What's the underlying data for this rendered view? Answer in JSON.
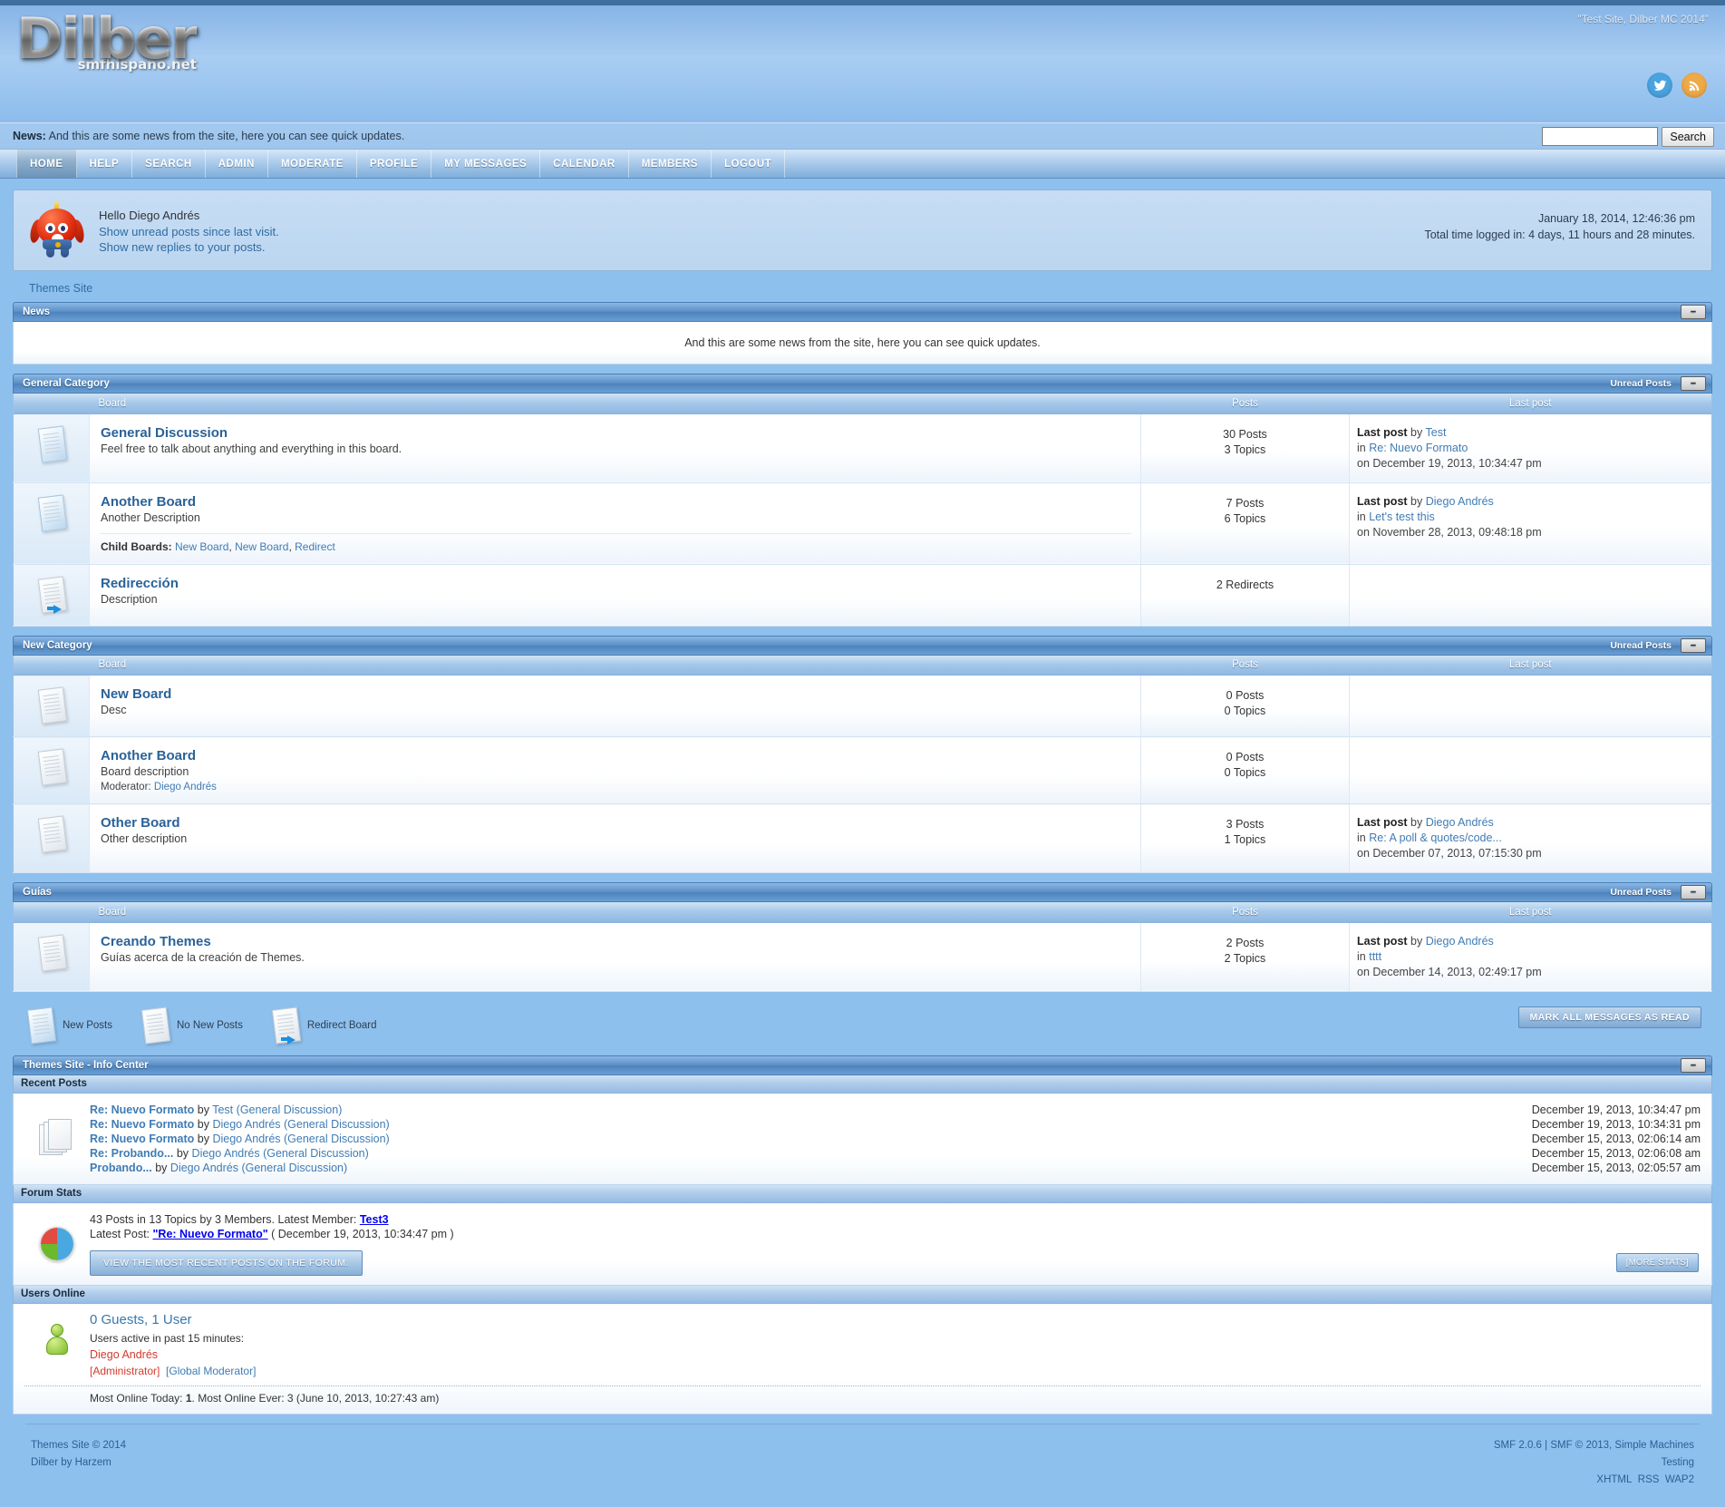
{
  "header": {
    "logo_main": "Dilber",
    "logo_sub": "smfhispano.net",
    "slogan": "\"Test Site, Dilber MC 2014\"",
    "social": [
      {
        "name": "twitter-icon",
        "glyph": "ᵗ"
      },
      {
        "name": "rss-icon",
        "glyph": "●"
      }
    ]
  },
  "news_strip": {
    "label": "News:",
    "text": " And this are some news from the site, here you can see quick updates.",
    "search_placeholder": "",
    "search_value": "",
    "search_button": "Search"
  },
  "menu": [
    {
      "label": "HOME",
      "active": true
    },
    {
      "label": "HELP",
      "active": false
    },
    {
      "label": "SEARCH",
      "active": false
    },
    {
      "label": "ADMIN",
      "active": false
    },
    {
      "label": "MODERATE",
      "active": false
    },
    {
      "label": "PROFILE",
      "active": false
    },
    {
      "label": "MY MESSAGES",
      "active": false
    },
    {
      "label": "CALENDAR",
      "active": false
    },
    {
      "label": "MEMBERS",
      "active": false
    },
    {
      "label": "LOGOUT",
      "active": false
    }
  ],
  "user_block": {
    "greeting": "Hello Diego Andrés",
    "link_unread": "Show unread posts since last visit.",
    "link_replies": "Show new replies to your posts.",
    "datetime": "January 18, 2014, 12:46:36 pm",
    "time_logged": "Total time logged in: 4 days, 11 hours and 28 minutes."
  },
  "breadcrumb": "Themes Site",
  "news_panel": {
    "title": "News",
    "collapse": "−",
    "body": "And this are some news from the site, here you can see quick updates."
  },
  "table_headers": {
    "board": "Board",
    "posts": "Posts",
    "last_post": "Last post"
  },
  "unread_label": "Unread Posts",
  "collapse_glyph": "−",
  "categories": [
    {
      "title": "General Category",
      "unread": "Unread Posts",
      "boards": [
        {
          "icon": "board-new-posts-icon",
          "name": "General Discussion",
          "desc": "Feel free to talk about anything and everything in this board.",
          "posts": "30 Posts",
          "topics": "3 Topics",
          "last_post_prefix": "Last post",
          "last_post_by": "by",
          "last_post_author": "Test",
          "last_post_in": "in",
          "last_post_topic": "Re: Nuevo Formato",
          "last_post_on": "on December 19, 2013, 10:34:47 pm",
          "children": null,
          "moderator": null
        },
        {
          "icon": "board-new-posts-icon",
          "name": "Another Board",
          "desc": "Another Description",
          "posts": "7 Posts",
          "topics": "6 Topics",
          "last_post_prefix": "Last post",
          "last_post_by": "by",
          "last_post_author": "Diego Andrés",
          "last_post_in": "in",
          "last_post_topic": "Let's test this",
          "last_post_on": "on November 28, 2013, 09:48:18 pm",
          "children": {
            "label": "Child Boards:",
            "items": [
              "New Board",
              "New Board",
              "Redirect"
            ]
          },
          "moderator": null
        },
        {
          "icon": "board-redirect-icon",
          "name": "Redirección",
          "desc": "Description",
          "posts": "2 Redirects",
          "topics": "",
          "last_post_prefix": "",
          "last_post_by": "",
          "last_post_author": "",
          "last_post_in": "",
          "last_post_topic": "",
          "last_post_on": "",
          "children": null,
          "moderator": null
        }
      ]
    },
    {
      "title": "New Category",
      "unread": "Unread Posts",
      "boards": [
        {
          "icon": "board-no-new-posts-icon",
          "name": "New Board",
          "desc": "Desc",
          "posts": "0 Posts",
          "topics": "0 Topics",
          "last_post_prefix": "",
          "last_post_by": "",
          "last_post_author": "",
          "last_post_in": "",
          "last_post_topic": "",
          "last_post_on": "",
          "children": null,
          "moderator": null
        },
        {
          "icon": "board-no-new-posts-icon",
          "name": "Another Board",
          "desc": "Board description",
          "posts": "0 Posts",
          "topics": "0 Topics",
          "last_post_prefix": "",
          "last_post_by": "",
          "last_post_author": "",
          "last_post_in": "",
          "last_post_topic": "",
          "last_post_on": "",
          "children": null,
          "moderator": {
            "label": "Moderator:",
            "name": "Diego Andrés"
          }
        },
        {
          "icon": "board-no-new-posts-icon",
          "name": "Other Board",
          "desc": "Other description",
          "posts": "3 Posts",
          "topics": "1 Topics",
          "last_post_prefix": "Last post",
          "last_post_by": "by",
          "last_post_author": "Diego Andrés",
          "last_post_in": "in",
          "last_post_topic": "Re: A poll & quotes/code...",
          "last_post_on": "on December 07, 2013, 07:15:30 pm",
          "children": null,
          "moderator": null
        }
      ]
    },
    {
      "title": "Guías",
      "unread": "Unread Posts",
      "boards": [
        {
          "icon": "board-no-new-posts-icon",
          "name": "Creando Themes",
          "desc": "Guías acerca de la creación de Themes.",
          "posts": "2 Posts",
          "topics": "2 Topics",
          "last_post_prefix": "Last post",
          "last_post_by": "by",
          "last_post_author": "Diego Andrés",
          "last_post_in": "in",
          "last_post_topic": "tttt",
          "last_post_on": "on December 14, 2013, 02:49:17 pm",
          "children": null,
          "moderator": null
        }
      ]
    }
  ],
  "legend": [
    {
      "icon": "new-posts-icon",
      "label": "New Posts"
    },
    {
      "icon": "no-new-posts-icon",
      "label": "No New Posts"
    },
    {
      "icon": "redirect-board-icon",
      "label": "Redirect Board"
    }
  ],
  "mark_all_read": "MARK ALL MESSAGES AS READ",
  "info_center": {
    "title": "Themes Site - Info Center",
    "collapse": "−",
    "recent_posts": {
      "title": "Recent Posts",
      "items": [
        {
          "subject": "Re: Nuevo Formato",
          "by": "by",
          "author": "Test",
          "board": "(General Discussion)",
          "date": "December 19, 2013, 10:34:47 pm"
        },
        {
          "subject": "Re: Nuevo Formato",
          "by": "by",
          "author": "Diego Andrés",
          "board": "(General Discussion)",
          "date": "December 19, 2013, 10:34:31 pm"
        },
        {
          "subject": "Re: Nuevo Formato",
          "by": "by",
          "author": "Diego Andrés",
          "board": "(General Discussion)",
          "date": "December 15, 2013, 02:06:14 am"
        },
        {
          "subject": "Re: Probando...",
          "by": "by",
          "author": "Diego Andrés",
          "board": "(General Discussion)",
          "date": "December 15, 2013, 02:06:08 am"
        },
        {
          "subject": "Probando...",
          "by": "by",
          "author": "Diego Andrés",
          "board": "(General Discussion)",
          "date": "December 15, 2013, 02:05:57 am"
        }
      ]
    },
    "forum_stats": {
      "title": "Forum Stats",
      "line1_prefix": "43 Posts in 13 Topics by 3 Members. Latest Member: ",
      "latest_member": "Test3",
      "line2_prefix": "Latest Post: ",
      "latest_post": "\"Re: Nuevo Formato\"",
      "latest_post_date": " ( December 19, 2013, 10:34:47 pm )",
      "view_recent_button": "VIEW THE MOST RECENT POSTS ON THE FORUM.",
      "more_stats_button": "[MORE STATS]"
    },
    "users_online": {
      "title": "Users Online",
      "summary": "0 Guests, 1 User",
      "active_label": "Users active in past 15 minutes:",
      "user": "Diego Andrés",
      "group_admin": "[Administrator]",
      "group_gm": "[Global Moderator]",
      "most_online": "Most Online Today: 1. Most Online Ever: 3 (June 10, 2013, 10:27:43 am)"
    }
  },
  "footer": {
    "left_line1": "Themes Site © 2014",
    "left_line2": "Dilber by Harzem",
    "right_line1": "SMF 2.0.6 | SMF © 2013, Simple Machines",
    "right_line2": "Testing",
    "right_xhtml": "XHTML",
    "right_rss": "RSS",
    "right_wap2": "WAP2"
  }
}
